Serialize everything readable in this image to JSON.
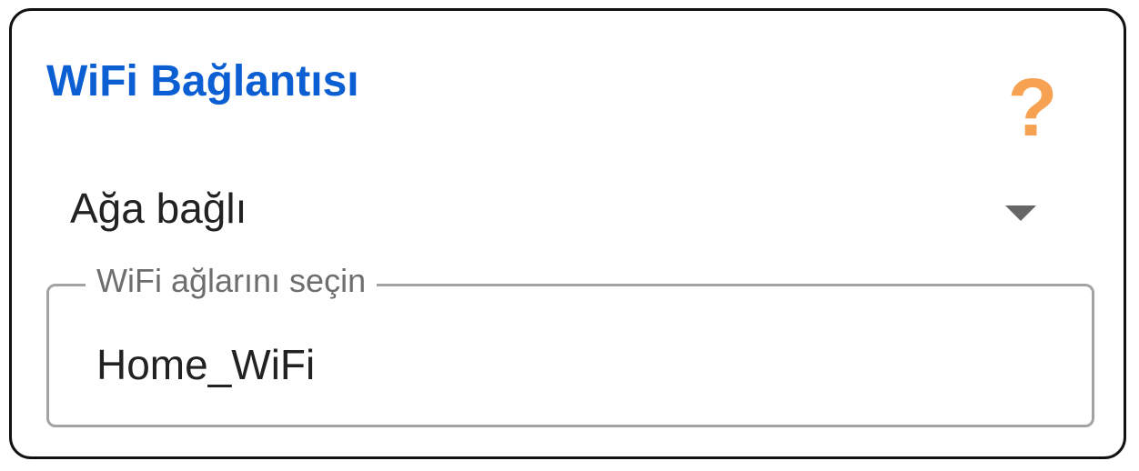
{
  "card": {
    "title": "WiFi Bağlantısı",
    "help_icon": "question-mark-icon",
    "help_glyph": "?"
  },
  "mode_select": {
    "selected": "Ağa bağlı",
    "caret_icon": "caret-down-icon"
  },
  "network_field": {
    "label": "WiFi ağlarını seçin",
    "value": "Home_WiFi"
  },
  "colors": {
    "title": "#0c5fd3",
    "help_icon": "#f6a252",
    "border": "#111111",
    "field_border": "#a3a3a3"
  }
}
